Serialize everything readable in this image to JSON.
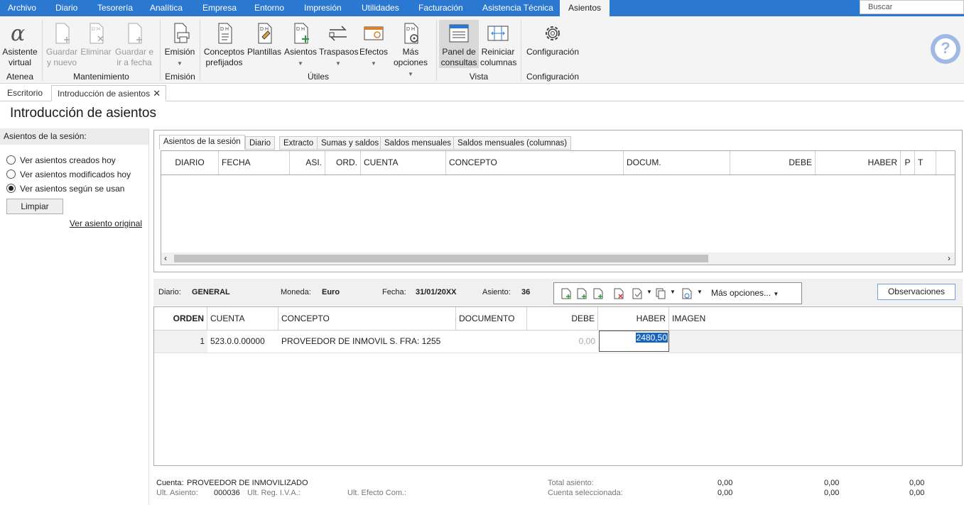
{
  "menu": {
    "items": [
      "Archivo",
      "Diario",
      "Tesorería",
      "Analítica",
      "Empresa",
      "Entorno",
      "Impresión",
      "Utilidades",
      "Facturación",
      "Asistencia Técnica",
      "Asientos"
    ],
    "search_placeholder": "Buscar"
  },
  "ribbon": {
    "asistente": "Asistente virtual",
    "guardar_nuevo": "Guardar y nuevo",
    "eliminar": "Eliminar",
    "guardar_fecha": "Guardar e ir a fecha",
    "emision": "Emisión",
    "conceptos": "Conceptos prefijados",
    "plantillas": "Plantillas",
    "asientos": "Asientos",
    "traspasos": "Traspasos",
    "efectos": "Efectos",
    "mas_opciones": "Más opciones",
    "panel_consultas": "Panel de consultas",
    "reiniciar": "Reiniciar columnas",
    "configuracion": "Configuración",
    "groups": {
      "atenea": "Atenea",
      "mantenimiento": "Mantenimiento",
      "emision": "Emisión",
      "utiles": "Útiles",
      "vista": "Vista",
      "configuracion": "Configuración"
    }
  },
  "doc_tabs": {
    "escritorio": "Escritorio",
    "intro": "Introducción de asientos"
  },
  "page_title": "Introducción de asientos",
  "left": {
    "header": "Asientos de la sesión:",
    "radios": [
      "Ver asientos creados hoy",
      "Ver asientos modificados hoy",
      "Ver asientos según se usan"
    ],
    "selected": 2,
    "limpiar": "Limpiar",
    "ver_original": "Ver asiento original"
  },
  "inner_tabs": [
    "Asientos de la sesión",
    "Diario",
    "Extracto",
    "Sumas y saldos",
    "Saldos mensuales",
    "Saldos mensuales (columnas)"
  ],
  "grid1_headers": [
    "DIARIO",
    "FECHA",
    "ASI.",
    "ORD.",
    "CUENTA",
    "CONCEPTO",
    "DOCUM.",
    "DEBE",
    "HABER",
    "P",
    "T"
  ],
  "info": {
    "diario_label": "Diario:",
    "diario": "GENERAL",
    "moneda_label": "Moneda:",
    "moneda": "Euro",
    "fecha_label": "Fecha:",
    "fecha": "31/01/20XX",
    "asiento_label": "Asiento:",
    "asiento": "36",
    "mas_opciones": "Más opciones...",
    "observaciones": "Observaciones"
  },
  "entry_headers": [
    "ORDEN",
    "CUENTA",
    "CONCEPTO",
    "DOCUMENTO",
    "DEBE",
    "HABER",
    "IMAGEN"
  ],
  "entry_row": {
    "orden": "1",
    "cuenta": "523.0.0.00000",
    "concepto": "PROVEEDOR DE INMOVIL S. FRA:  1255",
    "documento": "",
    "debe": "0,00",
    "haber": "2480,50"
  },
  "footer": {
    "cuenta_label": "Cuenta:",
    "cuenta": "PROVEEDOR DE INMOVILIZADO",
    "ult_asiento_label": "Ult. Asiento:",
    "ult_asiento": "000036",
    "ult_reg_iva": "Ult. Reg. I.V.A.:",
    "ult_efecto": "Ult. Efecto Com.:",
    "total_asiento": "Total asiento:",
    "cuenta_sel": "Cuenta seleccionada:",
    "values": [
      "0,00",
      "0,00",
      "0,00",
      "0,00",
      "0,00",
      "0,00"
    ]
  }
}
